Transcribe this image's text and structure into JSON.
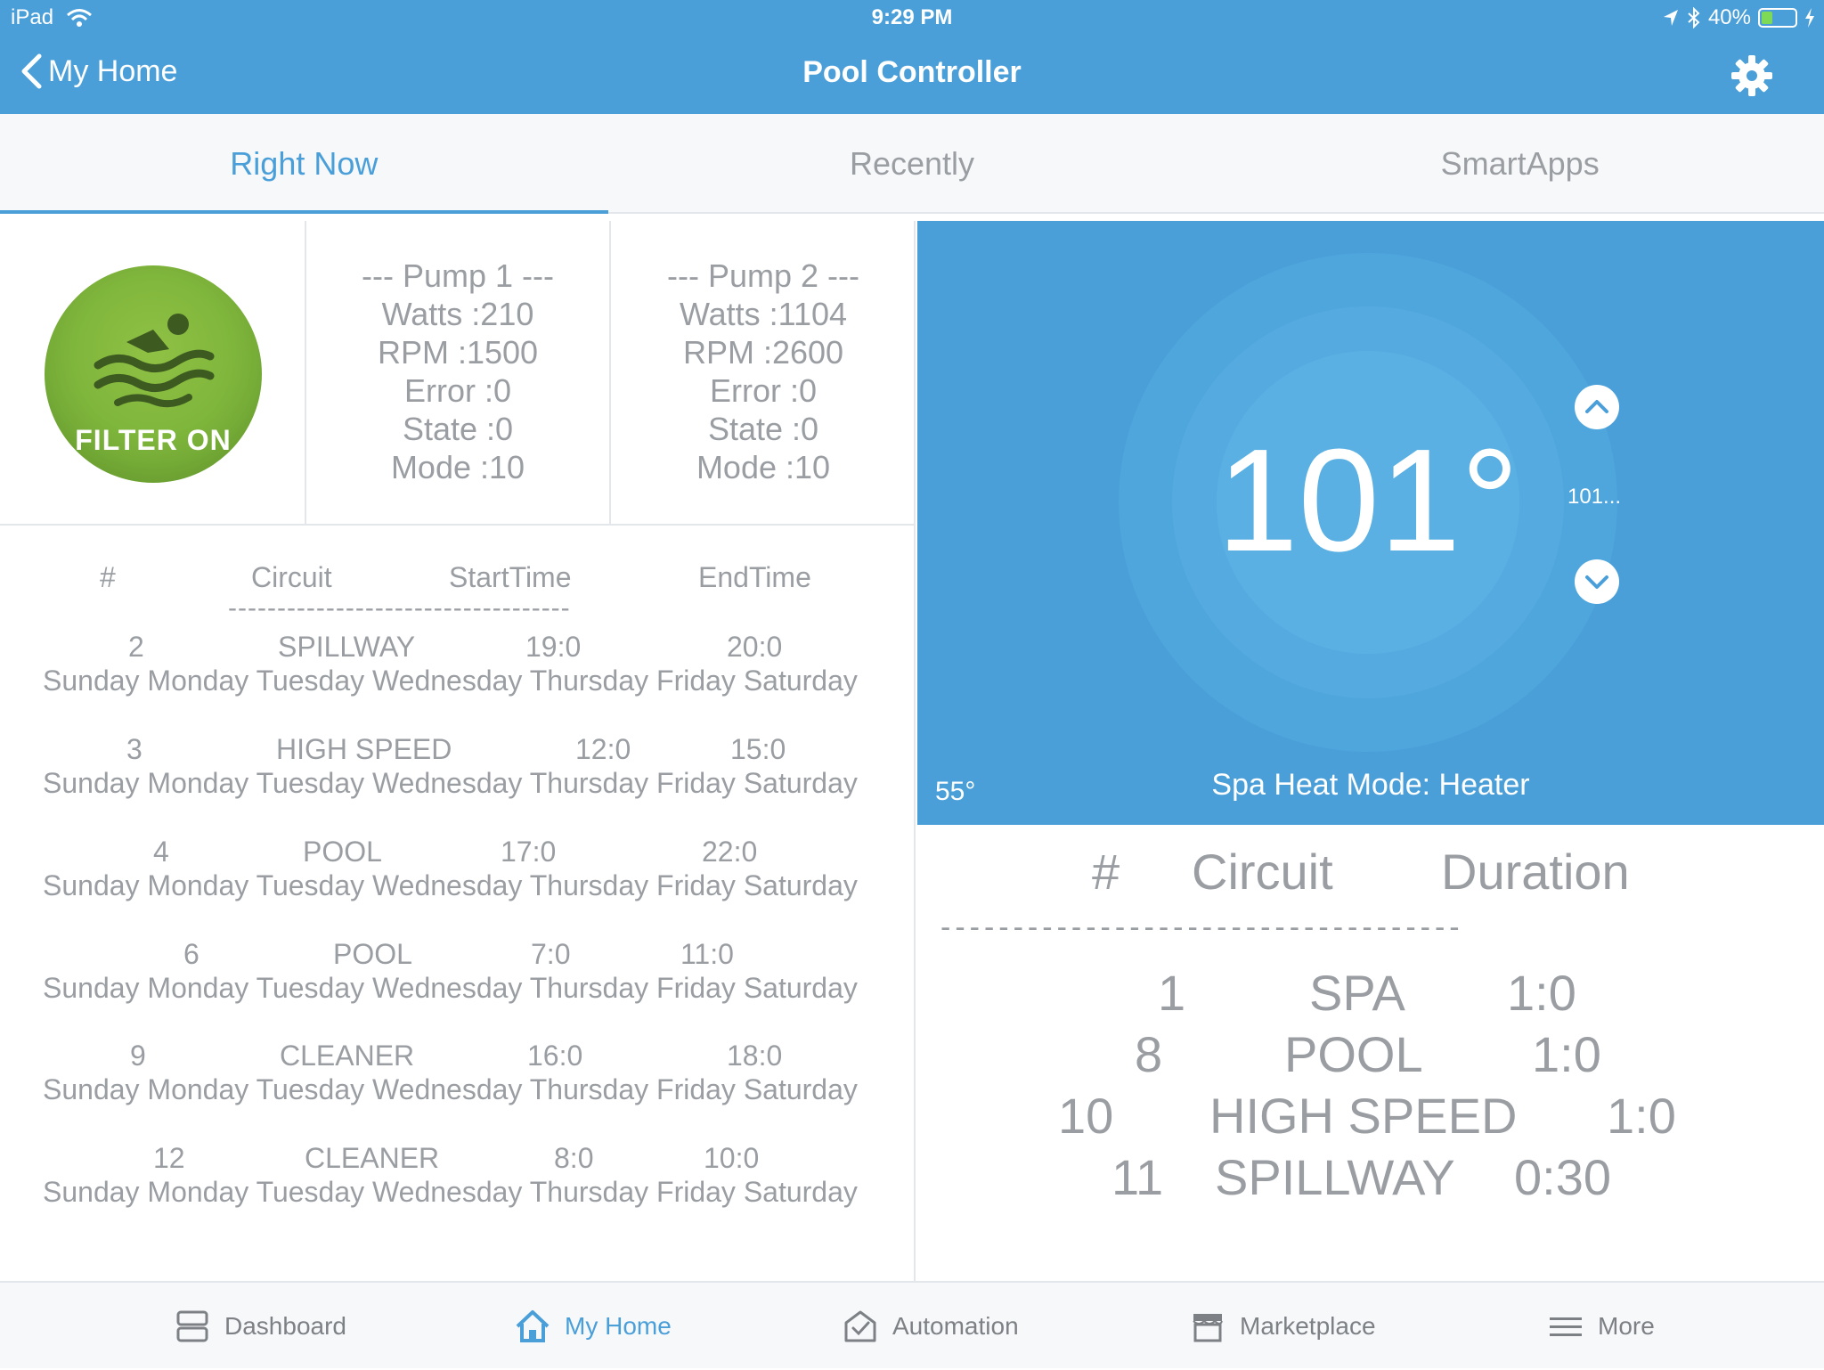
{
  "status_bar": {
    "device": "iPad",
    "time": "9:29 PM",
    "battery": "40%",
    "battery_level": 0.4
  },
  "nav": {
    "back_label": "My Home",
    "title": "Pool Controller"
  },
  "tabs": [
    {
      "label": "Right Now",
      "active": true
    },
    {
      "label": "Recently",
      "active": false
    },
    {
      "label": "SmartApps",
      "active": false
    }
  ],
  "filter_tile": {
    "label": "FILTER ON",
    "color": "#7bb33a"
  },
  "pumps": [
    {
      "title": "--- Pump 1 ---",
      "watts": "Watts :210",
      "rpm": "RPM :1500",
      "error": "Error :0",
      "state": "State :0",
      "mode": "Mode :10"
    },
    {
      "title": "--- Pump 2 ---",
      "watts": "Watts :1104",
      "rpm": "RPM :2600",
      "error": "Error :0",
      "state": "State :0",
      "mode": "Mode :10"
    }
  ],
  "schedule": {
    "headers": {
      "num": "#",
      "circuit": "Circuit",
      "start": "StartTime",
      "end": "EndTime"
    },
    "divider": "-----------------------------------",
    "days": "Sunday Monday Tuesday Wednesday Thursday Friday Saturday",
    "rows": [
      {
        "num": "2",
        "circuit": "SPILLWAY",
        "start": "19:0",
        "end": "20:0"
      },
      {
        "num": "3",
        "circuit": "HIGH SPEED",
        "start": "12:0",
        "end": "15:0"
      },
      {
        "num": "4",
        "circuit": "POOL",
        "start": "17:0",
        "end": "22:0"
      },
      {
        "num": "6",
        "circuit": "POOL",
        "start": "7:0",
        "end": "11:0"
      },
      {
        "num": "9",
        "circuit": "CLEANER",
        "start": "16:0",
        "end": "18:0"
      },
      {
        "num": "12",
        "circuit": "CLEANER",
        "start": "8:0",
        "end": "10:0"
      }
    ]
  },
  "thermostat": {
    "temperature": "101°",
    "setpoint": "101...",
    "low_temp": "55°",
    "mode_text": "Spa Heat Mode: Heater",
    "color": "#4a9fd9"
  },
  "durations": {
    "headers": {
      "num": "#",
      "circuit": "Circuit",
      "duration": "Duration"
    },
    "divider": "------------------------------------",
    "rows": [
      {
        "num": "1",
        "circuit": "SPA",
        "duration": "1:0"
      },
      {
        "num": "8",
        "circuit": "POOL",
        "duration": "1:0"
      },
      {
        "num": "10",
        "circuit": "HIGH SPEED",
        "duration": "1:0"
      },
      {
        "num": "11",
        "circuit": "SPILLWAY",
        "duration": "0:30"
      }
    ]
  },
  "bottom_tabs": [
    {
      "label": "Dashboard",
      "icon": "dashboard-icon",
      "active": false
    },
    {
      "label": "My Home",
      "icon": "home-icon",
      "active": true
    },
    {
      "label": "Automation",
      "icon": "automation-icon",
      "active": false
    },
    {
      "label": "Marketplace",
      "icon": "marketplace-icon",
      "active": false
    },
    {
      "label": "More",
      "icon": "menu-icon",
      "active": false
    }
  ]
}
